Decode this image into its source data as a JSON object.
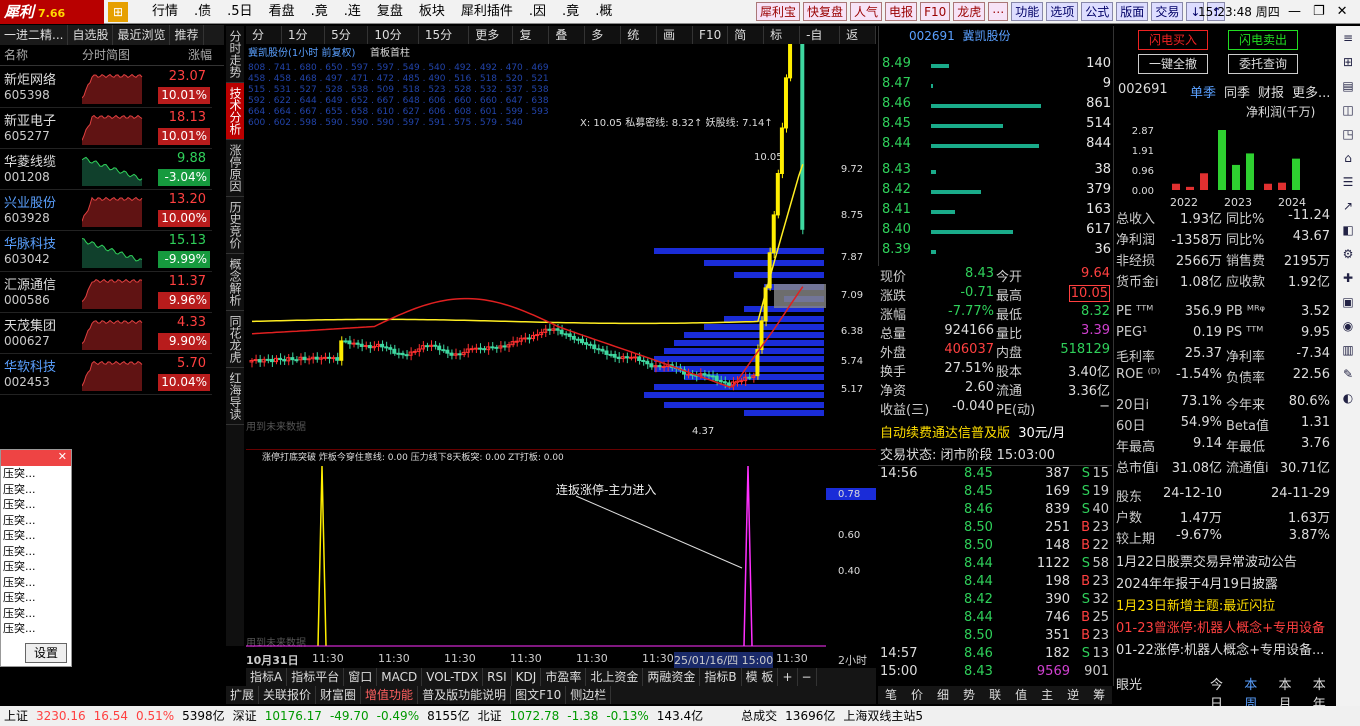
{
  "app": {
    "name": "犀利",
    "version": "7.66"
  },
  "menubar": {
    "items": [
      "行情",
      ".债",
      ".5日",
      "看盘",
      ".竟",
      ".连",
      "复盘",
      "板块",
      "犀利插件",
      ".因",
      ".竟",
      ".概"
    ],
    "right_buttons": [
      "犀利宝",
      "快复盘",
      "人气",
      "电报",
      "F10",
      "龙虎",
      "⋯",
      "功能",
      "选项",
      "公式",
      "版面",
      "交易",
      "↓",
      "↑"
    ],
    "clock": "15:23:48 周四"
  },
  "left_panel": {
    "tabs": [
      "一进二精...",
      "自选股",
      "最近浏览",
      "推荐"
    ],
    "headers": [
      "名称",
      "分时简图",
      "涨幅"
    ],
    "stocks": [
      {
        "name": "新炬网络",
        "code": "605398",
        "price": "23.07",
        "pct": "10.01%",
        "dir": "up"
      },
      {
        "name": "新亚电子",
        "code": "605277",
        "price": "18.13",
        "pct": "10.01%",
        "dir": "up"
      },
      {
        "name": "华菱线缆",
        "code": "001208",
        "price": "9.88",
        "pct": "-3.04%",
        "dir": "dn"
      },
      {
        "name": "兴业股份",
        "code": "603928",
        "price": "13.20",
        "pct": "10.00%",
        "dir": "up"
      },
      {
        "name": "华脉科技",
        "code": "603042",
        "price": "15.13",
        "pct": "-9.99%",
        "dir": "dn"
      },
      {
        "name": "汇源通信",
        "code": "000586",
        "price": "11.37",
        "pct": "9.96%",
        "dir": "up"
      },
      {
        "name": "天茂集团",
        "code": "000627",
        "price": "4.33",
        "pct": "9.90%",
        "dir": "up"
      },
      {
        "name": "华软科技",
        "code": "002453",
        "price": "5.70",
        "pct": "10.04%",
        "dir": "up"
      }
    ]
  },
  "popup": {
    "items": [
      "压突...",
      "压突...",
      "压突...",
      "压突...",
      "压突...",
      "压突...",
      "压突...",
      "压突...",
      "压突...",
      "压突...",
      "压突..."
    ],
    "button": "设置"
  },
  "vertical_tabs": [
    "分时走势",
    "技术分析",
    "涨停原因",
    "历史竞价",
    "概念解析",
    "同花龙虎",
    "红海导读"
  ],
  "chart": {
    "toolbar": [
      "分时",
      "1分钟",
      "5分钟",
      "10分钟",
      "15分钟",
      "更多 ›",
      "复权",
      "叠加",
      "多股",
      "统计",
      "画线",
      "F10",
      "简框",
      "标记",
      "-自选",
      "返回"
    ],
    "title": "冀凯股份(1小时 前复权)",
    "ma_label": "首板首柱",
    "info": "X: 10.05  私募密线: 8.32↑  妖股线: 7.14↑",
    "price_ticks": [
      "9.72",
      "8.75",
      "7.87",
      "7.09",
      "6.38",
      "5.74",
      "5.17"
    ],
    "high_label": "10.05",
    "low_label": "4.37",
    "watermark": "用到未来数据",
    "ind_title": "涨停打底突破  炸板今穿住意线: 0.00  压力线下8天板突: 0.00  ZT打板: 0.00",
    "ind_ticks": [
      "0.78",
      "0.60",
      "0.40"
    ],
    "annotation": "连扳涨停-主力进入",
    "x_labels": [
      "10月31日",
      "11:30",
      "11:30",
      "11:30",
      "11:30",
      "11:30",
      "11:30",
      "25/01/16/四 15:00",
      "11:30"
    ],
    "period": "2小时",
    "bottom_tabs": [
      "指标A",
      "指标平台",
      "窗口",
      "MACD",
      "VOL-TDX",
      "RSI",
      "KDJ",
      "市盈率",
      "北上资金",
      "两融资金",
      "指标B",
      "模 板",
      "+",
      "−"
    ],
    "bottom_tabs2": [
      "扩展",
      "关联报价",
      "财富圈",
      "增值功能",
      "普及版功能说明",
      "图文F10",
      "侧边栏"
    ]
  },
  "orderbook": {
    "code": "002691",
    "name": "冀凯股份",
    "asks": [
      {
        "price": "8.49",
        "vol": "140",
        "w": 0.15
      },
      {
        "price": "8.47",
        "vol": "9",
        "w": 0.02
      },
      {
        "price": "8.46",
        "vol": "861",
        "w": 0.92
      },
      {
        "price": "8.45",
        "vol": "514",
        "w": 0.6
      },
      {
        "price": "8.44",
        "vol": "844",
        "w": 0.9
      }
    ],
    "bids": [
      {
        "price": "8.43",
        "vol": "38",
        "w": 0.04
      },
      {
        "price": "8.42",
        "vol": "379",
        "w": 0.42
      },
      {
        "price": "8.41",
        "vol": "163",
        "w": 0.2
      },
      {
        "price": "8.40",
        "vol": "617",
        "w": 0.68
      },
      {
        "price": "8.39",
        "vol": "36",
        "w": 0.04
      }
    ]
  },
  "quote": [
    {
      "l1": "现价",
      "v1": "8.43",
      "c1": "#2fd05a",
      "l2": "今开",
      "v2": "9.64",
      "c2": "#ff4040"
    },
    {
      "l1": "涨跌",
      "v1": "-0.71",
      "c1": "#2fd05a",
      "l2": "最高",
      "v2": "10.05",
      "c2": "#ff4040"
    },
    {
      "l1": "涨幅",
      "v1": "-7.77%",
      "c1": "#2fd05a",
      "l2": "最低",
      "v2": "8.32",
      "c2": "#2fd05a"
    },
    {
      "l1": "总量",
      "v1": "924166",
      "c1": "#ddd",
      "l2": "量比",
      "v2": "3.39",
      "c2": "#d040d0"
    },
    {
      "l1": "外盘",
      "v1": "406037",
      "c1": "#ff4040",
      "l2": "内盘",
      "v2": "518129",
      "c2": "#2fd05a"
    },
    {
      "l1": "换手",
      "v1": "27.51%",
      "c1": "#ddd",
      "l2": "股本",
      "v2": "3.40亿",
      "c2": "#ddd"
    },
    {
      "l1": "净资",
      "v1": "2.60",
      "c1": "#ddd",
      "l2": "流通",
      "v2": "3.36亿",
      "c2": "#ddd"
    },
    {
      "l1": "收益(三)",
      "v1": "-0.040",
      "c1": "#ddd",
      "l2": "PE(动)",
      "v2": "−",
      "c2": "#ddd"
    }
  ],
  "ad": {
    "text": "自动续费通达信普及版",
    "price": "30元/月"
  },
  "trade_status": "交易状态: 闭市阶段 15:03:00",
  "ticks": [
    {
      "t": "14:56",
      "p": "8.45",
      "v": "387",
      "s": "S",
      "n": "15"
    },
    {
      "t": "",
      "p": "8.45",
      "v": "169",
      "s": "S",
      "n": "19"
    },
    {
      "t": "",
      "p": "8.46",
      "v": "839",
      "s": "S",
      "n": "40"
    },
    {
      "t": "",
      "p": "8.50",
      "v": "251",
      "s": "B",
      "n": "23"
    },
    {
      "t": "",
      "p": "8.50",
      "v": "148",
      "s": "B",
      "n": "22"
    },
    {
      "t": "",
      "p": "8.44",
      "v": "1122",
      "s": "S",
      "n": "58"
    },
    {
      "t": "",
      "p": "8.44",
      "v": "198",
      "s": "B",
      "n": "23"
    },
    {
      "t": "",
      "p": "8.42",
      "v": "390",
      "s": "S",
      "n": "32"
    },
    {
      "t": "",
      "p": "8.44",
      "v": "746",
      "s": "B",
      "n": "25"
    },
    {
      "t": "",
      "p": "8.50",
      "v": "351",
      "s": "B",
      "n": "23"
    },
    {
      "t": "14:57",
      "p": "8.46",
      "v": "182",
      "s": "S",
      "n": "13"
    },
    {
      "t": "15:00",
      "p": "8.43",
      "v": "9569",
      "s": "",
      "n": "901"
    }
  ],
  "side_tabs": [
    "笔",
    "价",
    "细",
    "势",
    "联",
    "值",
    "主",
    "逆",
    "筹"
  ],
  "right": {
    "btn_buy": "闪电买入",
    "btn_sell": "闪电卖出",
    "btn_all": "一键全撤",
    "btn_query": "委托查询",
    "code": "002691",
    "tabs": [
      "单季",
      "同季",
      "财报",
      "更多..."
    ],
    "fin_title": "净利润(千万)",
    "fin_ticks": [
      "2.87",
      "1.91",
      "0.96",
      "0.00"
    ],
    "fin_years": [
      "2022",
      "2023",
      "2024"
    ],
    "fin_bars": [
      {
        "v": 0.3,
        "c": "#e03030"
      },
      {
        "v": 0.15,
        "c": "#e03030"
      },
      {
        "v": 0.8,
        "c": "#e03030"
      },
      {
        "v": 2.87,
        "c": "#2ed030"
      },
      {
        "v": 1.2,
        "c": "#2ed030"
      },
      {
        "v": 1.75,
        "c": "#2ed030"
      },
      {
        "v": 0.3,
        "c": "#e03030"
      },
      {
        "v": 0.35,
        "c": "#e03030"
      },
      {
        "v": 1.5,
        "c": "#2ed030"
      }
    ],
    "fund1": [
      {
        "l1": "总收入",
        "v1": "1.93亿",
        "c1": "#ddd",
        "l2": "同比%",
        "v2": "-11.24",
        "c2": "#ddd"
      },
      {
        "l1": "净利润",
        "v1": "-1358万",
        "c1": "#ddd",
        "l2": "同比%",
        "v2": "43.67",
        "c2": "#ddd"
      },
      {
        "l1": "非经损",
        "v1": "2566万",
        "c1": "#ddd",
        "l2": "销售费",
        "v2": "2195万",
        "c2": "#ddd"
      },
      {
        "l1": "货币金i",
        "v1": "1.08亿",
        "c1": "#ddd",
        "l2": "应收款",
        "v2": "1.92亿",
        "c2": "#ddd"
      }
    ],
    "fund2": [
      {
        "l1": "PE ᵀᵀᴹ",
        "v1": "356.9",
        "c1": "#ddd",
        "l2": "PB ᴹᴿᵠ",
        "v2": "3.52",
        "c2": "#ddd"
      },
      {
        "l1": "PEG¹",
        "v1": "0.19",
        "c1": "#ddd",
        "l2": "PS ᵀᵀᴹ",
        "v2": "9.95",
        "c2": "#ddd"
      },
      {
        "l1": "毛利率",
        "v1": "25.37",
        "c1": "#ddd",
        "l2": "净利率",
        "v2": "-7.34",
        "c2": "#ddd"
      },
      {
        "l1": "ROE ⁽ᴰ⁾",
        "v1": "-1.54%",
        "c1": "#ddd",
        "l2": "负债率",
        "v2": "22.56",
        "c2": "#ddd"
      }
    ],
    "fund3": [
      {
        "l1": "20日i",
        "v1": "73.1%",
        "c1": "#ddd",
        "l2": "今年来",
        "v2": "80.6%",
        "c2": "#ddd"
      },
      {
        "l1": "60日",
        "v1": "54.9%",
        "c1": "#ddd",
        "l2": "Beta值",
        "v2": "1.31",
        "c2": "#ddd"
      },
      {
        "l1": "年最高",
        "v1": "9.14",
        "c1": "#ddd",
        "l2": "年最低",
        "v2": "3.76",
        "c2": "#ddd"
      },
      {
        "l1": "总市值i",
        "v1": "31.08亿",
        "c1": "#ddd",
        "l2": "流通值i",
        "v2": "30.71亿",
        "c2": "#ddd"
      }
    ],
    "fund4": [
      {
        "l1": "股东",
        "v1": "24-12-10",
        "c1": "#ddd",
        "l2": "",
        "v2": "24-11-29",
        "c2": "#ddd"
      },
      {
        "l1": "户数",
        "v1": "1.47万",
        "c1": "#ddd",
        "l2": "",
        "v2": "1.63万",
        "c2": "#ddd"
      },
      {
        "l1": "较上期",
        "v1": "-9.67%",
        "c1": "#ddd",
        "l2": "",
        "v2": "3.87%",
        "c2": "#ddd"
      }
    ],
    "news": [
      {
        "t": "1月22日股票交易异常波动公告",
        "c": "#ddd"
      },
      {
        "t": "2024年年报于4月19日披露",
        "c": "#ddd"
      },
      {
        "t": "1月23日新增主题:最近闪拉",
        "c": "#ffde00"
      },
      {
        "t": "01-23曾涨停:机器人概念+专用设备",
        "c": "#ff4040"
      },
      {
        "t": "01-22涨停:机器人概念+专用设备...",
        "c": "#ddd"
      }
    ],
    "eye": "眼光",
    "eye_tabs": [
      "今日",
      "本周",
      "本月",
      "本年"
    ]
  },
  "status": {
    "sh_label": "上证",
    "sh": "3230.16",
    "sh_chg": "16.54",
    "sh_pct": "0.51%",
    "sh_amt": "5398亿",
    "sz_label": "深证",
    "sz": "10176.17",
    "sz_chg": "-49.70",
    "sz_pct": "-0.49%",
    "sz_amt": "8155亿",
    "bz_label": "北证",
    "bz": "1072.78",
    "bz_chg": "-1.38",
    "bz_pct": "-0.13%",
    "bz_amt": "143.4亿",
    "total_label": "总成交",
    "total": "13696亿",
    "server": "上海双线主站5"
  }
}
